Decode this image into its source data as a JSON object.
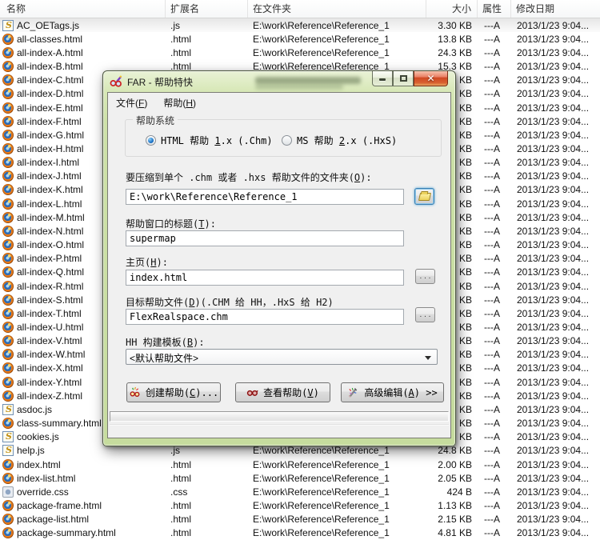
{
  "file_list": {
    "columns": [
      "名称",
      "扩展名",
      "在文件夹",
      "大小",
      "属性",
      "修改日期"
    ],
    "shared": {
      "folder": "E:\\work\\Reference\\Reference_1",
      "attributes": "---A",
      "modified": "2013/1/23 9:04..."
    },
    "rows": [
      {
        "name": "AC_OETags.js",
        "ext": ".js",
        "icon": "js",
        "size": "3.30 KB",
        "highlighted": true
      },
      {
        "name": "all-classes.html",
        "ext": ".html",
        "icon": "html",
        "size": "13.8 KB"
      },
      {
        "name": "all-index-A.html",
        "ext": ".html",
        "icon": "html",
        "size": "24.3 KB"
      },
      {
        "name": "all-index-B.html",
        "ext": ".html",
        "icon": "html",
        "size": "15.3 KB"
      },
      {
        "name": "all-index-C.html",
        "ext": ".html",
        "icon": "html",
        "size": "KB"
      },
      {
        "name": "all-index-D.html",
        "ext": ".html",
        "icon": "html",
        "size": "KB"
      },
      {
        "name": "all-index-E.html",
        "ext": ".html",
        "icon": "html",
        "size": "KB"
      },
      {
        "name": "all-index-F.html",
        "ext": ".html",
        "icon": "html",
        "size": "KB"
      },
      {
        "name": "all-index-G.html",
        "ext": ".html",
        "icon": "html",
        "size": "KB"
      },
      {
        "name": "all-index-H.html",
        "ext": ".html",
        "icon": "html",
        "size": "KB"
      },
      {
        "name": "all-index-I.html",
        "ext": ".html",
        "icon": "html",
        "size": "KB"
      },
      {
        "name": "all-index-J.html",
        "ext": ".html",
        "icon": "html",
        "size": "KB"
      },
      {
        "name": "all-index-K.html",
        "ext": ".html",
        "icon": "html",
        "size": "KB"
      },
      {
        "name": "all-index-L.html",
        "ext": ".html",
        "icon": "html",
        "size": "KB"
      },
      {
        "name": "all-index-M.html",
        "ext": ".html",
        "icon": "html",
        "size": "KB"
      },
      {
        "name": "all-index-N.html",
        "ext": ".html",
        "icon": "html",
        "size": "KB"
      },
      {
        "name": "all-index-O.html",
        "ext": ".html",
        "icon": "html",
        "size": "KB"
      },
      {
        "name": "all-index-P.html",
        "ext": ".html",
        "icon": "html",
        "size": "KB"
      },
      {
        "name": "all-index-Q.html",
        "ext": ".html",
        "icon": "html",
        "size": "KB"
      },
      {
        "name": "all-index-R.html",
        "ext": ".html",
        "icon": "html",
        "size": "KB"
      },
      {
        "name": "all-index-S.html",
        "ext": ".html",
        "icon": "html",
        "size": "KB"
      },
      {
        "name": "all-index-T.html",
        "ext": ".html",
        "icon": "html",
        "size": "KB"
      },
      {
        "name": "all-index-U.html",
        "ext": ".html",
        "icon": "html",
        "size": "KB"
      },
      {
        "name": "all-index-V.html",
        "ext": ".html",
        "icon": "html",
        "size": "KB"
      },
      {
        "name": "all-index-W.html",
        "ext": ".html",
        "icon": "html",
        "size": "KB"
      },
      {
        "name": "all-index-X.html",
        "ext": ".html",
        "icon": "html",
        "size": "KB"
      },
      {
        "name": "all-index-Y.html",
        "ext": ".html",
        "icon": "html",
        "size": "KB"
      },
      {
        "name": "all-index-Z.html",
        "ext": ".html",
        "icon": "html",
        "size": "KB"
      },
      {
        "name": "asdoc.js",
        "ext": ".js",
        "icon": "js",
        "size": "KB"
      },
      {
        "name": "class-summary.html",
        "ext": ".html",
        "icon": "html",
        "size": "KB"
      },
      {
        "name": "cookies.js",
        "ext": ".js",
        "icon": "js",
        "size": "KB"
      },
      {
        "name": "help.js",
        "ext": ".js",
        "icon": "js",
        "size": "24.8 KB"
      },
      {
        "name": "index.html",
        "ext": ".html",
        "icon": "html",
        "size": "2.00 KB"
      },
      {
        "name": "index-list.html",
        "ext": ".html",
        "icon": "html",
        "size": "2.05 KB"
      },
      {
        "name": "override.css",
        "ext": ".css",
        "icon": "css",
        "size": "424 B"
      },
      {
        "name": "package-frame.html",
        "ext": ".html",
        "icon": "html",
        "size": "1.13 KB"
      },
      {
        "name": "package-list.html",
        "ext": ".html",
        "icon": "html",
        "size": "2.15 KB"
      },
      {
        "name": "package-summary.html",
        "ext": ".html",
        "icon": "html",
        "size": "4.81 KB"
      }
    ]
  },
  "dialog": {
    "title": "FAR - 帮助特快",
    "menu": [
      {
        "text": "文件(F)",
        "accel": "F"
      },
      {
        "text": "帮助(H)",
        "accel": "H"
      }
    ],
    "help_system_group": {
      "label": "帮助系统",
      "radios": [
        {
          "text": "HTML 帮助 1.x (.Chm)",
          "accel": "1",
          "selected": true
        },
        {
          "text": "MS 帮助 2.x (.HxS)",
          "accel": "2",
          "selected": false
        }
      ]
    },
    "fields": {
      "folder": {
        "label": {
          "text": "要压缩到单个 .chm 或者 .hxs 帮助文件的文件夹(O):",
          "accel": "O"
        },
        "value": "E:\\work\\Reference\\Reference_1"
      },
      "window_title": {
        "label": {
          "text": "帮助窗口的标题(T):",
          "accel": "T"
        },
        "value": "supermap"
      },
      "home_page": {
        "label": {
          "text": "主页(H):",
          "accel": "H"
        },
        "value": "index.html",
        "browse_label": ". . ."
      },
      "target_file": {
        "label": {
          "text": "目标帮助文件(D)(.CHM 给 HH，.HxS 给 H2)",
          "accel": "D"
        },
        "value": "FlexRealspace.chm",
        "browse_label": ". . ."
      },
      "template": {
        "label": {
          "text": "HH 构建模板(B):",
          "accel": "B"
        },
        "value": "<默认帮助文件>"
      }
    },
    "buttons": [
      {
        "text": "创建帮助(C)...",
        "accel": "C"
      },
      {
        "text": "查看帮助(V)",
        "accel": "V"
      },
      {
        "text": "高级编辑(A) >>",
        "accel": "A"
      }
    ],
    "accent_colors": {
      "titlebar_green": "#cde1a8",
      "close_button_red": "#d8602f",
      "radio_dot_blue": "#1d74c9"
    }
  }
}
